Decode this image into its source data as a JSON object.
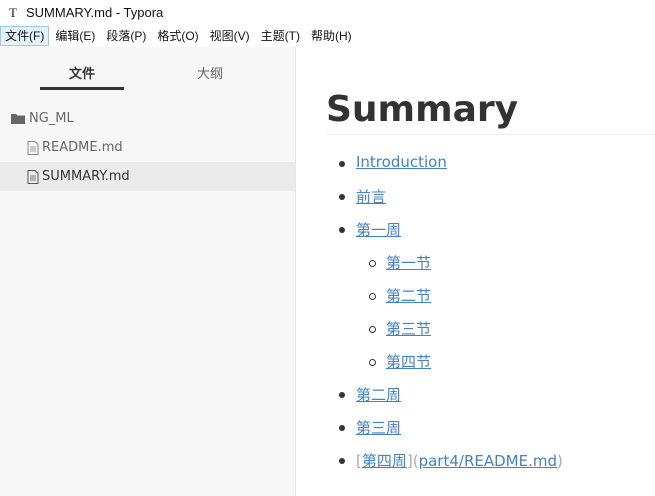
{
  "window": {
    "title": "SUMMARY.md - Typora",
    "icon": "typora-T-icon"
  },
  "menu": [
    "文件(F)",
    "编辑(E)",
    "段落(P)",
    "格式(O)",
    "视图(V)",
    "主题(T)",
    "帮助(H)"
  ],
  "sidebar": {
    "tabs": [
      "文件",
      "大纲"
    ],
    "active_tab": "文件",
    "tree": [
      {
        "type": "folder",
        "label": "NG_ML"
      },
      {
        "type": "file",
        "label": "README.md"
      },
      {
        "type": "file",
        "label": "SUMMARY.md",
        "selected": true
      }
    ]
  },
  "editor": {
    "heading": "Summary",
    "items": [
      {
        "level": 1,
        "text": "Introduction",
        "link": true
      },
      {
        "level": 1,
        "text": "前言",
        "link": true
      },
      {
        "level": 1,
        "text": "第一周",
        "link": true
      },
      {
        "level": 2,
        "text": "第一节",
        "link": true
      },
      {
        "level": 2,
        "text": "第二节",
        "link": true
      },
      {
        "level": 2,
        "text": "第三节",
        "link": true
      },
      {
        "level": 2,
        "text": "第四节",
        "link": true
      },
      {
        "level": 1,
        "text": "第二周",
        "link": true
      },
      {
        "level": 1,
        "text": "第三周",
        "link": true
      }
    ],
    "raw_item": {
      "open_bracket": "[",
      "link_text": "第四周",
      "close_bracket": "]",
      "open_paren": "(",
      "url": "part4/README.md",
      "close_paren": ")"
    }
  },
  "colors": {
    "link": "#4183c4",
    "sidebar_bg": "#f7f7f7",
    "selected_bg": "#eaeaea"
  }
}
